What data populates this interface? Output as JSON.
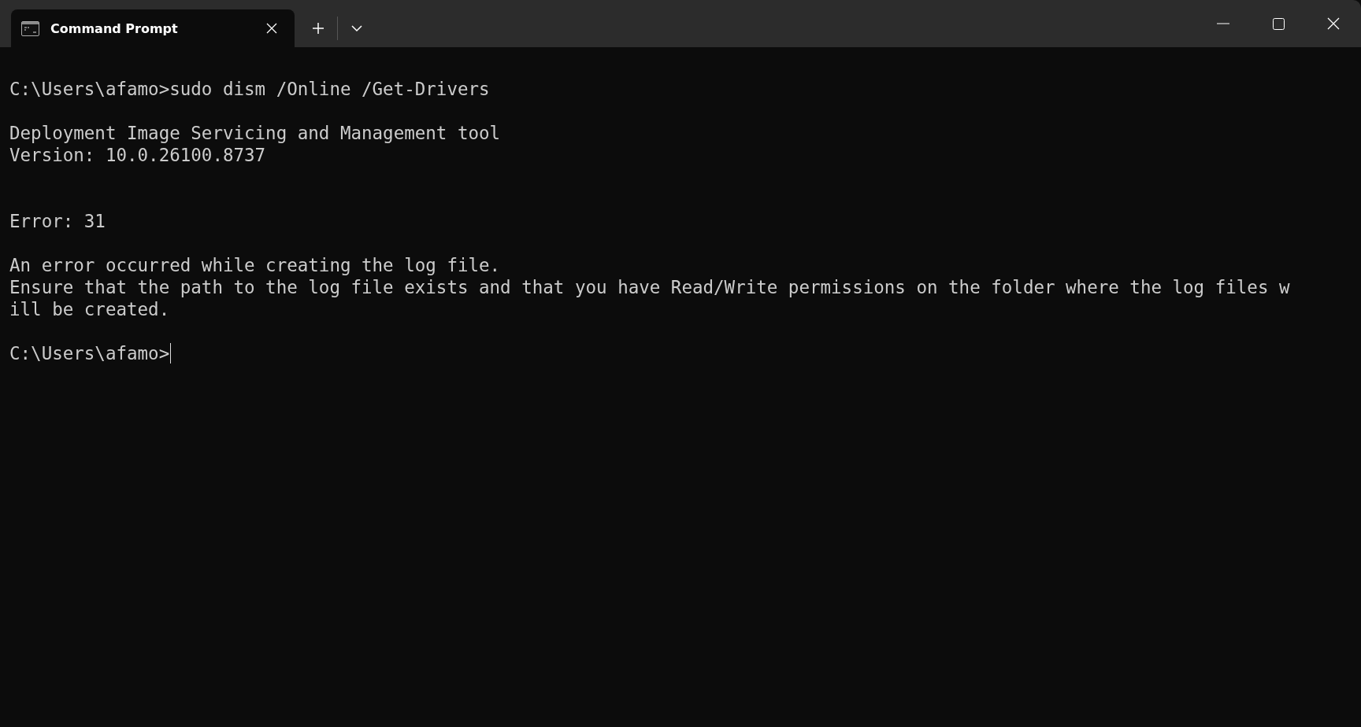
{
  "tabs": [
    {
      "title": "Command Prompt",
      "selected": true
    }
  ],
  "terminal": {
    "lines": [
      {
        "kind": "text",
        "text": "C:\\Users\\afamo>sudo dism /Online /Get-Drivers"
      },
      {
        "kind": "blank"
      },
      {
        "kind": "text",
        "text": "Deployment Image Servicing and Management tool"
      },
      {
        "kind": "text",
        "text": "Version: 10.0.26100.8737"
      },
      {
        "kind": "blank"
      },
      {
        "kind": "blank"
      },
      {
        "kind": "text",
        "text": "Error: 31"
      },
      {
        "kind": "blank"
      },
      {
        "kind": "text",
        "text": "An error occurred while creating the log file."
      },
      {
        "kind": "text",
        "text": "Ensure that the path to the log file exists and that you have Read/Write permissions on the folder where the log files w"
      },
      {
        "kind": "text",
        "text": "ill be created."
      },
      {
        "kind": "blank"
      },
      {
        "kind": "prompt",
        "text": "C:\\Users\\afamo>",
        "cursor": true
      }
    ]
  }
}
